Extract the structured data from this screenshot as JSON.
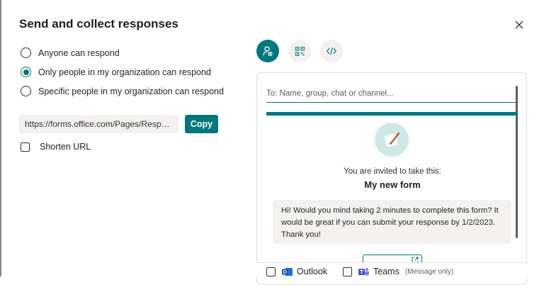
{
  "dialog": {
    "title": "Send and collect responses",
    "close_icon": "close-icon"
  },
  "audience": {
    "options": [
      {
        "label": "Anyone can respond",
        "selected": false
      },
      {
        "label": "Only people in my organization can respond",
        "selected": true
      },
      {
        "label": "Specific people in my organization can respond",
        "selected": false
      }
    ]
  },
  "link": {
    "url": "https://forms.office.com/Pages/ResponsePage.aspx",
    "copy_label": "Copy",
    "shorten_label": "Shorten URL",
    "shorten_checked": false
  },
  "share_tabs": [
    {
      "icon": "invite-people-icon",
      "active": true
    },
    {
      "icon": "qr-code-icon",
      "active": false
    },
    {
      "icon": "embed-code-icon",
      "active": false
    }
  ],
  "invite": {
    "to_placeholder": "To: Name, group, chat or channel...",
    "invited_text": "You are invited to take this:",
    "form_name": "My new form",
    "message_lines": [
      "Hi! Would you mind taking 2 minutes to complete this form? It",
      "would be great if you can submit your response by 1/2/2023.",
      "Thank you!"
    ]
  },
  "send_options": {
    "outlook_label": "Outlook",
    "teams_label": "Teams",
    "teams_note": "(Message only)"
  },
  "colors": {
    "accent": "#03787c"
  }
}
